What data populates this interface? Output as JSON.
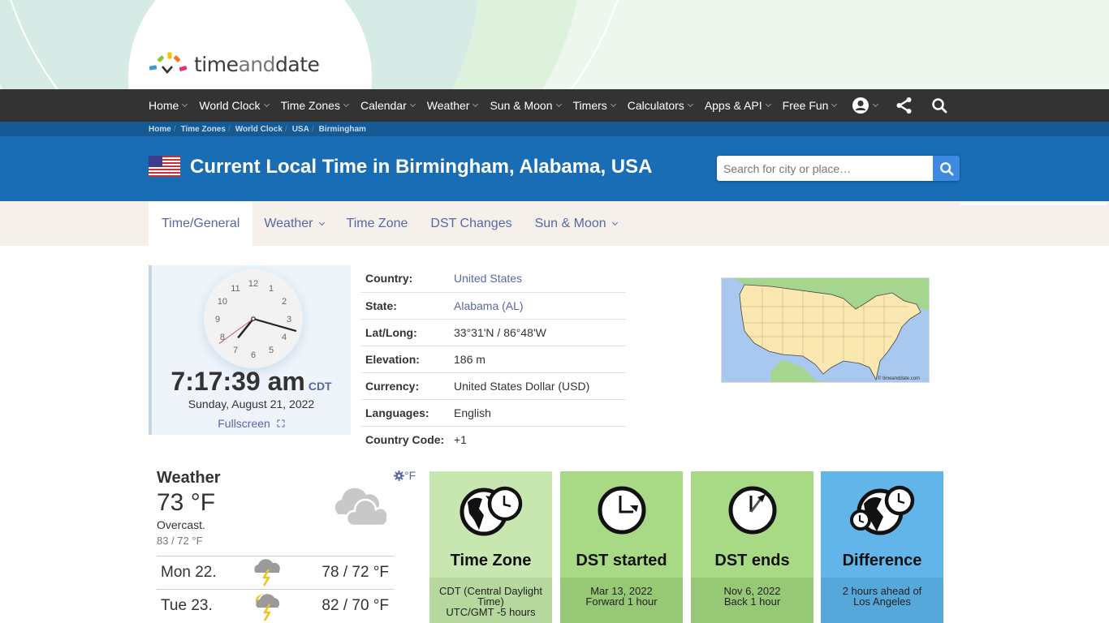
{
  "brand": {
    "logo_part1": "time",
    "logo_part2": "and",
    "logo_part3": "date",
    "colors": {
      "nav_bg": "#333333",
      "breadcrumb_bg": "#155a93",
      "title_bg": "#196db5",
      "link": "#5a67a5",
      "tile_timezone": "#c8e6b0",
      "tile_dst": "#a8d985",
      "tile_difference": "#62b5e8"
    }
  },
  "nav": {
    "items": [
      {
        "label": "Home"
      },
      {
        "label": "World Clock"
      },
      {
        "label": "Time Zones"
      },
      {
        "label": "Calendar"
      },
      {
        "label": "Weather"
      },
      {
        "label": "Sun & Moon"
      },
      {
        "label": "Timers"
      },
      {
        "label": "Calculators"
      },
      {
        "label": "Apps & API"
      },
      {
        "label": "Free Fun"
      }
    ],
    "icons": [
      "user-icon",
      "share-icon",
      "search-icon"
    ]
  },
  "breadcrumb": [
    "Home",
    "Time Zones",
    "World Clock",
    "USA",
    "Birmingham"
  ],
  "header": {
    "title": "Current Local Time in Birmingham, Alabama, USA",
    "search_placeholder": "Search for city or place…"
  },
  "tabs": [
    {
      "label": "Time/General",
      "active": true,
      "dropdown": false
    },
    {
      "label": "Weather",
      "active": false,
      "dropdown": true
    },
    {
      "label": "Time Zone",
      "active": false,
      "dropdown": false
    },
    {
      "label": "DST Changes",
      "active": false,
      "dropdown": false
    },
    {
      "label": "Sun & Moon",
      "active": false,
      "dropdown": true
    }
  ],
  "clock": {
    "time": "7:17:39 am",
    "tz": "CDT",
    "date": "Sunday, August 21, 2022",
    "fullscreen_label": "Fullscreen",
    "hour": 7,
    "minute": 17,
    "second": 39,
    "numerals": [
      "12",
      "1",
      "2",
      "3",
      "4",
      "5",
      "6",
      "7",
      "8",
      "9",
      "10",
      "11"
    ]
  },
  "info": [
    {
      "label": "Country:",
      "value": "United States",
      "link": true
    },
    {
      "label": "State:",
      "value": "Alabama (AL)",
      "link": true
    },
    {
      "label": "Lat/Long:",
      "value": "33°31'N / 86°48'W",
      "link": false
    },
    {
      "label": "Elevation:",
      "value": "186 m",
      "link": false
    },
    {
      "label": "Currency:",
      "value": "United States Dollar (USD)",
      "link": false
    },
    {
      "label": "Languages:",
      "value": "English",
      "link": false
    },
    {
      "label": "Country Code:",
      "value": "+1",
      "link": false
    }
  ],
  "map": {
    "credit": "© timeanddate.com"
  },
  "weather": {
    "title": "Weather",
    "temp": "73 °F",
    "condition": "Overcast.",
    "range": "83 / 72 °F",
    "unit_label": "°F",
    "icon": "overcast-cloud-icon",
    "forecast": [
      {
        "day": "Mon 22.",
        "temps": "78 / 72 °F",
        "icon": "thunderstorm-icon"
      },
      {
        "day": "Tue 23.",
        "temps": "82 / 70 °F",
        "icon": "partly-sunny-thunderstorm-icon"
      }
    ]
  },
  "tiles": [
    {
      "title": "Time Zone",
      "line1": "CDT (Central Daylight Time)",
      "line2": "UTC/GMT -5 hours",
      "icon": "globe-clock-icon"
    },
    {
      "title": "DST started",
      "line1": "Mar 13, 2022",
      "line2": "Forward 1 hour",
      "icon": "clock-forward-icon"
    },
    {
      "title": "DST ends",
      "line1": "Nov 6, 2022",
      "line2": "Back 1 hour",
      "icon": "clock-back-icon"
    },
    {
      "title": "Difference",
      "line1": "2 hours ahead of",
      "line2": "Los Angeles",
      "icon": "globe-clocks-icon"
    }
  ]
}
